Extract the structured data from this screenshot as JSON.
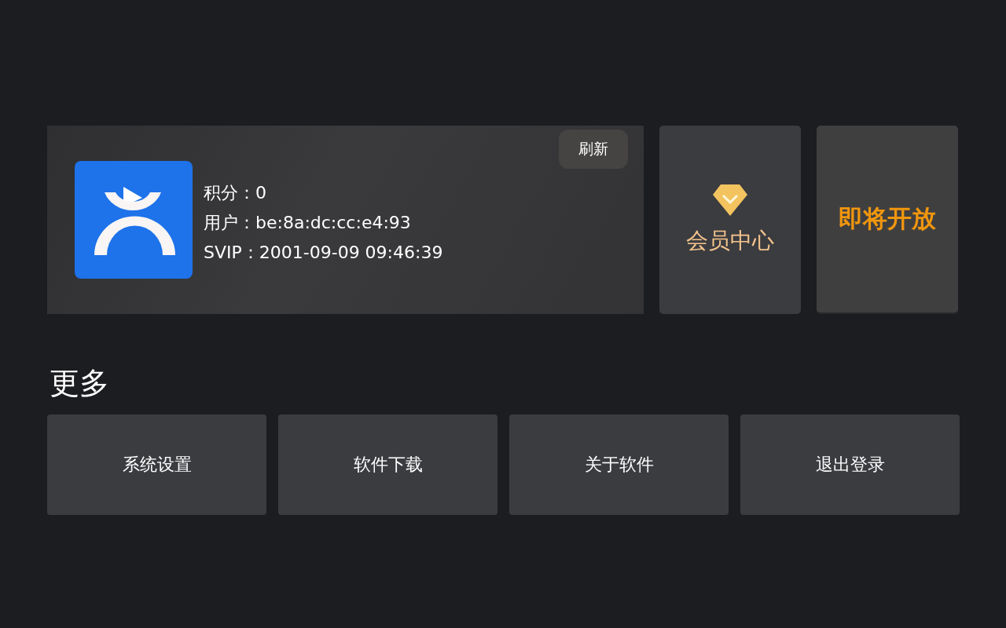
{
  "profile": {
    "refresh_button": "刷新",
    "points": "积分：0",
    "user": "用户：be:8a:dc:cc:e4:93",
    "svip": "SVIP：2001-09-09 09:46:39"
  },
  "member_center": {
    "label": "会员中心"
  },
  "coming_soon": {
    "label": "即将开放"
  },
  "more": {
    "title": "更多",
    "items": [
      "系统设置",
      "软件下载",
      "关于软件",
      "退出登录"
    ]
  }
}
